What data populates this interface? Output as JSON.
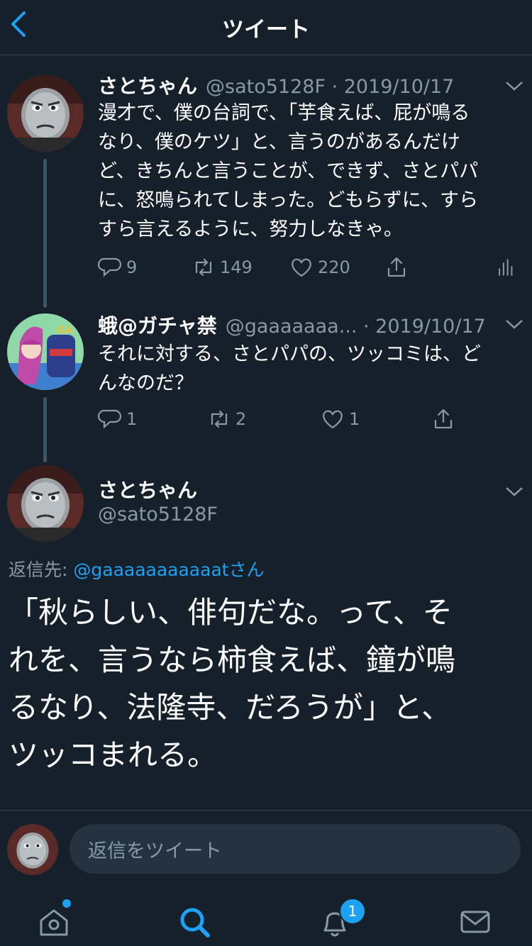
{
  "header": {
    "title": "ツイート"
  },
  "tweets": [
    {
      "name": "さとちゃん",
      "meta": "@sato5128F · 2019/10/17",
      "lines": [
        "漫才で、僕の台詞で、「芋食えば、屁が鳴る",
        "なり、僕のケツ」と、言うのがあるんだけ",
        "ど、きちんと言うことが、できず、さとパパ",
        "に、怒鳴られてしまった。どもらずに、すら",
        "すら言えるように、努力しなきゃ。"
      ],
      "replies": "9",
      "retweets": "149",
      "likes": "220"
    },
    {
      "name": "蛾@ガチャ禁",
      "meta": "@gaaaaaaa... · 2019/10/17",
      "lines": [
        "それに対する、さとパパの、ツッコミは、ど",
        "んなのだ？"
      ],
      "replies": "1",
      "retweets": "2",
      "likes": "1"
    }
  ],
  "main_tweet": {
    "name": "さとちゃん",
    "handle": "@sato5128F",
    "reply_prefix": "返信先: ",
    "reply_link": "@gaaaaaaaaaaat",
    "reply_suffix": "さん",
    "lines": [
      "「秋らしい、俳句だな。って、そ",
      "れを、言うなら柿食えば、鐘が鳴",
      "るなり、法隆寺、だろうが」と、",
      "ツッコまれる。"
    ]
  },
  "compose": {
    "placeholder": "返信をツイート"
  },
  "tabbar": {
    "notifications_badge": "1",
    "icons": [
      "home-icon",
      "search-icon",
      "bell-icon",
      "mail-icon"
    ]
  },
  "colors": {
    "background": "#15202b",
    "accent": "#1da1f2",
    "muted": "#8899a6",
    "border": "#38444d"
  }
}
